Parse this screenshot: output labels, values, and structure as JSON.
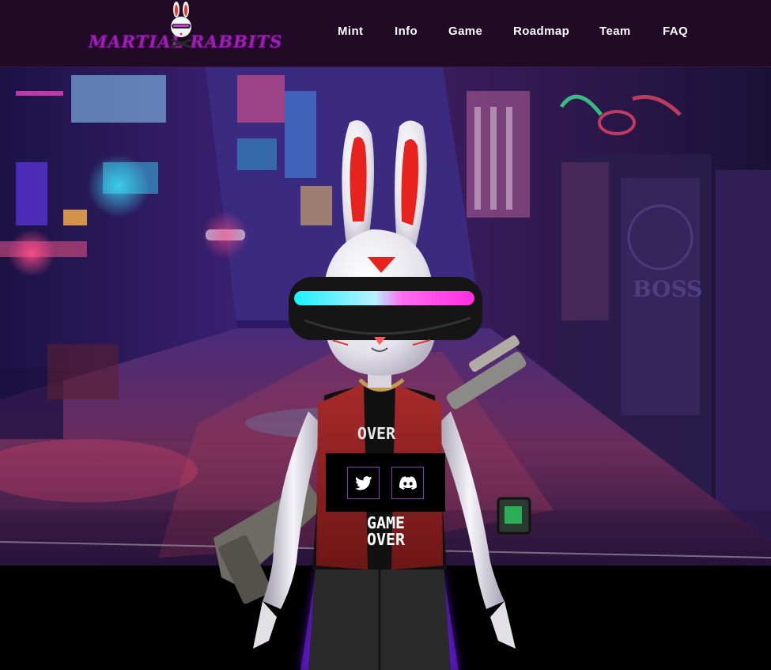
{
  "brand": {
    "logo_text": "MARTIAL RABBITS"
  },
  "nav": {
    "items": [
      {
        "label": "Mint"
      },
      {
        "label": "Info"
      },
      {
        "label": "Game"
      },
      {
        "label": "Roadmap"
      },
      {
        "label": "Team"
      },
      {
        "label": "FAQ"
      }
    ]
  },
  "hero": {
    "shirt_text_top": "OVER",
    "shirt_text_game": "GAME",
    "shirt_text_over": "OVER",
    "sign_text": "BOSS"
  },
  "social": {
    "twitter_icon": "twitter-icon",
    "discord_icon": "discord-icon"
  },
  "colors": {
    "header_bg": "#210a26",
    "logo_purple": "#9b1fb0",
    "accent_purple": "#8a36c4",
    "nav_text": "#ffffff"
  }
}
